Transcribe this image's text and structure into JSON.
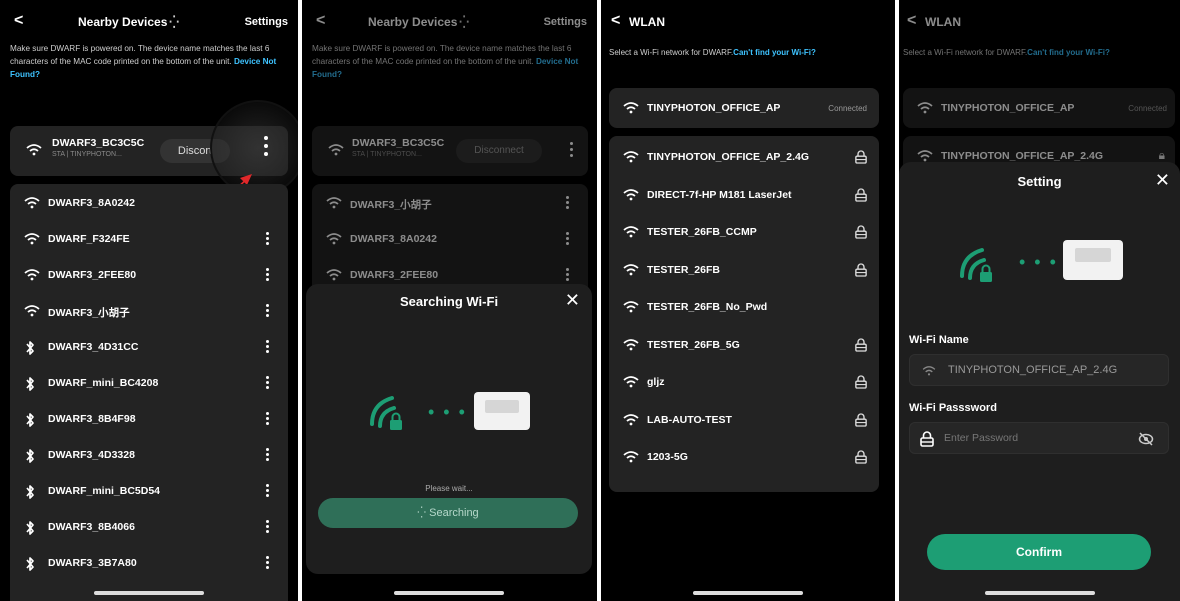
{
  "panel1": {
    "back": "<",
    "title": "Nearby Devices",
    "settings": "Settings",
    "desc_text": "Make sure DWARF is powered on. The device name matches the last 6 characters of the MAC code printed on the bottom of the unit.",
    "desc_link": "Device Not Found?",
    "connected_device": {
      "name": "DWARF3_BC3C5C",
      "sub": "STA | TINYPHOTON...",
      "button": "Discort"
    },
    "devices": [
      {
        "name": "DWARF3_8A0242",
        "icon": "wifi-icon"
      },
      {
        "name": "DWARF_F324FE",
        "icon": "wifi-icon"
      },
      {
        "name": "DWARF3_2FEE80",
        "icon": "wifi-icon"
      },
      {
        "name": "DWARF3_小胡子",
        "icon": "wifi-icon"
      },
      {
        "name": "DWARF3_4D31CC",
        "icon": "bluetooth-icon"
      },
      {
        "name": "DWARF_mini_BC4208",
        "icon": "bluetooth-icon"
      },
      {
        "name": "DWARF3_8B4F98",
        "icon": "bluetooth-icon"
      },
      {
        "name": "DWARF3_4D3328",
        "icon": "bluetooth-icon"
      },
      {
        "name": "DWARF_mini_BC5D54",
        "icon": "bluetooth-icon"
      },
      {
        "name": "DWARF3_8B4066",
        "icon": "bluetooth-icon"
      },
      {
        "name": "DWARF3_3B7A80",
        "icon": "bluetooth-icon"
      }
    ]
  },
  "panel2": {
    "back": "<",
    "title": "Nearby Devices",
    "settings": "Settings",
    "desc_text": "Make sure DWARF is powered on. The device name matches the last 6 characters of the MAC code printed on the bottom of the unit.",
    "desc_link": "Device Not Found?",
    "connected_device": {
      "name": "DWARF3_BC3C5C",
      "sub": "STA | TINYPHOTON...",
      "button": "Disconnect"
    },
    "devices": [
      {
        "name": "DWARF3_小胡子"
      },
      {
        "name": "DWARF3_8A0242"
      },
      {
        "name": "DWARF3_2FEE80"
      }
    ],
    "sheet": {
      "title": "Searching Wi-Fi",
      "wait": "Please wait...",
      "button": "Searching"
    }
  },
  "panel3": {
    "back": "<",
    "title": "WLAN",
    "desc_text": "Select a Wi-Fi network for DWARF.",
    "desc_link": "Can't find your Wi-Fi?",
    "current": {
      "name": "TINYPHOTON_OFFICE_AP",
      "status": "Connected"
    },
    "networks": [
      {
        "name": "TINYPHOTON_OFFICE_AP_2.4G",
        "locked": true
      },
      {
        "name": "DIRECT-7f-HP M181 LaserJet",
        "locked": true
      },
      {
        "name": "TESTER_26FB_CCMP",
        "locked": true
      },
      {
        "name": "TESTER_26FB",
        "locked": true
      },
      {
        "name": "TESTER_26FB_No_Pwd",
        "locked": false
      },
      {
        "name": "TESTER_26FB_5G",
        "locked": true
      },
      {
        "name": "gljz",
        "locked": true
      },
      {
        "name": "LAB-AUTO-TEST",
        "locked": true
      },
      {
        "name": "1203-5G",
        "locked": true
      }
    ]
  },
  "panel4": {
    "back": "<",
    "title": "WLAN",
    "desc_text": "Select a Wi-Fi network for DWARF.",
    "desc_link": "Can't find your Wi-Fi?",
    "current": {
      "name": "TINYPHOTON_OFFICE_AP",
      "status": "Connected"
    },
    "second": {
      "name": "TINYPHOTON_OFFICE_AP_2.4G"
    },
    "sheet": {
      "title": "Setting",
      "wifi_name_label": "Wi-Fi Name",
      "wifi_name_value": "TINYPHOTON_OFFICE_AP_2.4G",
      "password_label": "Wi-Fi Passsword",
      "password_placeholder": "Enter Password",
      "confirm": "Confirm"
    }
  },
  "colors": {
    "accent_green": "#1d9e74",
    "link_blue": "#3ec3ff",
    "arrow_red": "#e0282a"
  }
}
